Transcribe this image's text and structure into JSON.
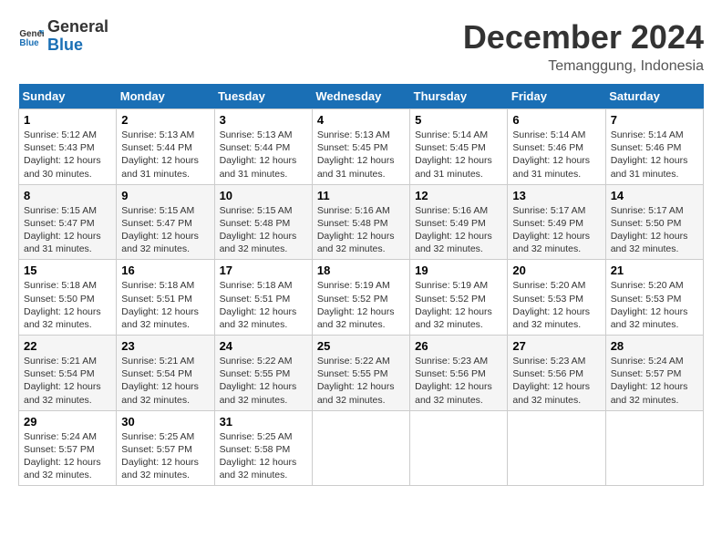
{
  "logo": {
    "text_general": "General",
    "text_blue": "Blue"
  },
  "title": "December 2024",
  "location": "Temanggung, Indonesia",
  "days_of_week": [
    "Sunday",
    "Monday",
    "Tuesday",
    "Wednesday",
    "Thursday",
    "Friday",
    "Saturday"
  ],
  "weeks": [
    [
      {
        "day": "1",
        "sunrise": "5:12 AM",
        "sunset": "5:43 PM",
        "daylight": "12 hours and 30 minutes."
      },
      {
        "day": "2",
        "sunrise": "5:13 AM",
        "sunset": "5:44 PM",
        "daylight": "12 hours and 31 minutes."
      },
      {
        "day": "3",
        "sunrise": "5:13 AM",
        "sunset": "5:44 PM",
        "daylight": "12 hours and 31 minutes."
      },
      {
        "day": "4",
        "sunrise": "5:13 AM",
        "sunset": "5:45 PM",
        "daylight": "12 hours and 31 minutes."
      },
      {
        "day": "5",
        "sunrise": "5:14 AM",
        "sunset": "5:45 PM",
        "daylight": "12 hours and 31 minutes."
      },
      {
        "day": "6",
        "sunrise": "5:14 AM",
        "sunset": "5:46 PM",
        "daylight": "12 hours and 31 minutes."
      },
      {
        "day": "7",
        "sunrise": "5:14 AM",
        "sunset": "5:46 PM",
        "daylight": "12 hours and 31 minutes."
      }
    ],
    [
      {
        "day": "8",
        "sunrise": "5:15 AM",
        "sunset": "5:47 PM",
        "daylight": "12 hours and 31 minutes."
      },
      {
        "day": "9",
        "sunrise": "5:15 AM",
        "sunset": "5:47 PM",
        "daylight": "12 hours and 32 minutes."
      },
      {
        "day": "10",
        "sunrise": "5:15 AM",
        "sunset": "5:48 PM",
        "daylight": "12 hours and 32 minutes."
      },
      {
        "day": "11",
        "sunrise": "5:16 AM",
        "sunset": "5:48 PM",
        "daylight": "12 hours and 32 minutes."
      },
      {
        "day": "12",
        "sunrise": "5:16 AM",
        "sunset": "5:49 PM",
        "daylight": "12 hours and 32 minutes."
      },
      {
        "day": "13",
        "sunrise": "5:17 AM",
        "sunset": "5:49 PM",
        "daylight": "12 hours and 32 minutes."
      },
      {
        "day": "14",
        "sunrise": "5:17 AM",
        "sunset": "5:50 PM",
        "daylight": "12 hours and 32 minutes."
      }
    ],
    [
      {
        "day": "15",
        "sunrise": "5:18 AM",
        "sunset": "5:50 PM",
        "daylight": "12 hours and 32 minutes."
      },
      {
        "day": "16",
        "sunrise": "5:18 AM",
        "sunset": "5:51 PM",
        "daylight": "12 hours and 32 minutes."
      },
      {
        "day": "17",
        "sunrise": "5:18 AM",
        "sunset": "5:51 PM",
        "daylight": "12 hours and 32 minutes."
      },
      {
        "day": "18",
        "sunrise": "5:19 AM",
        "sunset": "5:52 PM",
        "daylight": "12 hours and 32 minutes."
      },
      {
        "day": "19",
        "sunrise": "5:19 AM",
        "sunset": "5:52 PM",
        "daylight": "12 hours and 32 minutes."
      },
      {
        "day": "20",
        "sunrise": "5:20 AM",
        "sunset": "5:53 PM",
        "daylight": "12 hours and 32 minutes."
      },
      {
        "day": "21",
        "sunrise": "5:20 AM",
        "sunset": "5:53 PM",
        "daylight": "12 hours and 32 minutes."
      }
    ],
    [
      {
        "day": "22",
        "sunrise": "5:21 AM",
        "sunset": "5:54 PM",
        "daylight": "12 hours and 32 minutes."
      },
      {
        "day": "23",
        "sunrise": "5:21 AM",
        "sunset": "5:54 PM",
        "daylight": "12 hours and 32 minutes."
      },
      {
        "day": "24",
        "sunrise": "5:22 AM",
        "sunset": "5:55 PM",
        "daylight": "12 hours and 32 minutes."
      },
      {
        "day": "25",
        "sunrise": "5:22 AM",
        "sunset": "5:55 PM",
        "daylight": "12 hours and 32 minutes."
      },
      {
        "day": "26",
        "sunrise": "5:23 AM",
        "sunset": "5:56 PM",
        "daylight": "12 hours and 32 minutes."
      },
      {
        "day": "27",
        "sunrise": "5:23 AM",
        "sunset": "5:56 PM",
        "daylight": "12 hours and 32 minutes."
      },
      {
        "day": "28",
        "sunrise": "5:24 AM",
        "sunset": "5:57 PM",
        "daylight": "12 hours and 32 minutes."
      }
    ],
    [
      {
        "day": "29",
        "sunrise": "5:24 AM",
        "sunset": "5:57 PM",
        "daylight": "12 hours and 32 minutes."
      },
      {
        "day": "30",
        "sunrise": "5:25 AM",
        "sunset": "5:57 PM",
        "daylight": "12 hours and 32 minutes."
      },
      {
        "day": "31",
        "sunrise": "5:25 AM",
        "sunset": "5:58 PM",
        "daylight": "12 hours and 32 minutes."
      },
      null,
      null,
      null,
      null
    ]
  ]
}
